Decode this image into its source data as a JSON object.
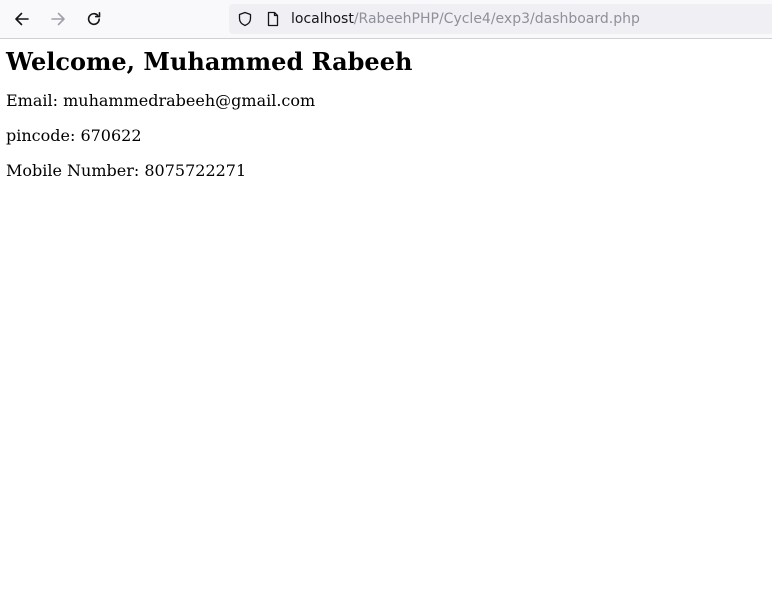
{
  "browser": {
    "url_host": "localhost",
    "url_path": "/RabeehPHP/Cycle4/exp3/dashboard.php",
    "icons": {
      "back": "arrow-left-icon",
      "forward": "arrow-right-icon",
      "reload": "reload-icon",
      "tracking_protection": "shield-icon",
      "page_info": "page-icon"
    },
    "forward_enabled": false
  },
  "page": {
    "heading": "Welcome, Muhammed Rabeeh",
    "email_line": "Email: muhammedrabeeh@gmail.com",
    "pincode_line": "pincode: 670622",
    "mobile_line": "Mobile Number: 8075722271"
  },
  "colors": {
    "toolbar_bg": "#f9f9fb",
    "urlbar_bg": "#f0f0f4",
    "url_host": "#15141a",
    "url_path": "#8f8f9d",
    "icon_active": "#15141a",
    "icon_disabled": "#a0a0a8",
    "page_text": "#000000"
  }
}
